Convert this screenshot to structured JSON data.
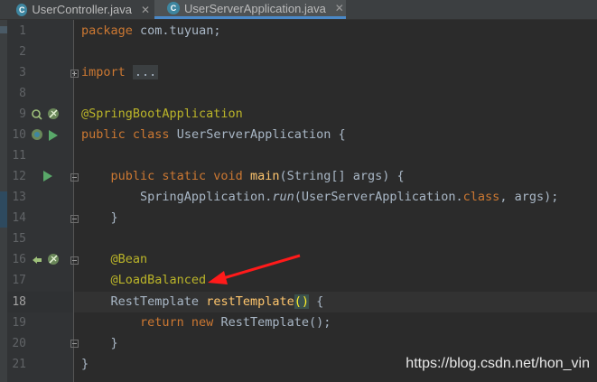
{
  "tabs": [
    {
      "label": "UserController.java",
      "active": false
    },
    {
      "label": "UserServerApplication.java",
      "active": true
    }
  ],
  "lines": [
    {
      "n": "1",
      "code": "package com.tuyuan;"
    },
    {
      "n": "2",
      "code": ""
    },
    {
      "n": "3",
      "code": "import ..."
    },
    {
      "n": "8",
      "code": ""
    },
    {
      "n": "9",
      "code": "@SpringBootApplication"
    },
    {
      "n": "10",
      "code": "public class UserServerApplication {"
    },
    {
      "n": "11",
      "code": ""
    },
    {
      "n": "12",
      "code": "    public static void main(String[] args) {"
    },
    {
      "n": "13",
      "code": "        SpringApplication.run(UserServerApplication.class, args);"
    },
    {
      "n": "14",
      "code": "    }"
    },
    {
      "n": "15",
      "code": ""
    },
    {
      "n": "16",
      "code": "    @Bean"
    },
    {
      "n": "17",
      "code": "    @LoadBalanced"
    },
    {
      "n": "18",
      "code": "    RestTemplate restTemplate() {"
    },
    {
      "n": "19",
      "code": "        return new RestTemplate();"
    },
    {
      "n": "20",
      "code": "    }"
    },
    {
      "n": "21",
      "code": "}"
    }
  ],
  "current_line": "18",
  "watermark": "https://blog.csdn.net/hon_vin",
  "colors": {
    "background": "#2B2B2B",
    "keyword": "#CC7832",
    "annotation": "#BBB529",
    "method": "#FFC66D",
    "text": "#A9B7C6",
    "arrow": "#FF1A1A"
  }
}
